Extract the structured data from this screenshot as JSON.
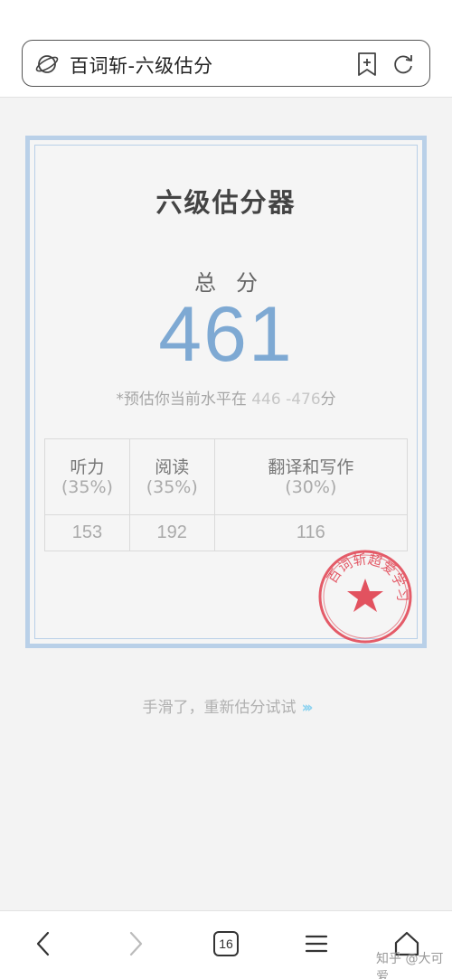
{
  "browser": {
    "url_text": "百词斩-六级估分",
    "tab_count": "16"
  },
  "card": {
    "title": "六级估分器",
    "total_label": "总分",
    "total_score": "461",
    "estimate_prefix": "*预估你当前水平在 ",
    "estimate_range": "446 -476",
    "estimate_suffix": "分",
    "columns": [
      {
        "name": "听力",
        "percent": "(35%)",
        "score": "153"
      },
      {
        "name": "阅读",
        "percent": "(35%)",
        "score": "192"
      },
      {
        "name": "翻译和写作",
        "percent": "(30%)",
        "score": "116"
      }
    ],
    "stamp_text": "百词斩超爱学习"
  },
  "retry_link": "手滑了，重新估分试试",
  "watermark": "知乎 @大可爱",
  "colors": {
    "accent": "#7ea9d3",
    "card_border": "#b9d0e8",
    "stamp_red": "#e0404f",
    "link_arrow": "#8fd3f0"
  },
  "icons": [
    "planet-icon",
    "bookmark-add-icon",
    "refresh-icon",
    "back-icon",
    "forward-icon",
    "tabs-icon",
    "menu-icon",
    "home-icon",
    "star-icon",
    "double-chevron-right-icon"
  ]
}
